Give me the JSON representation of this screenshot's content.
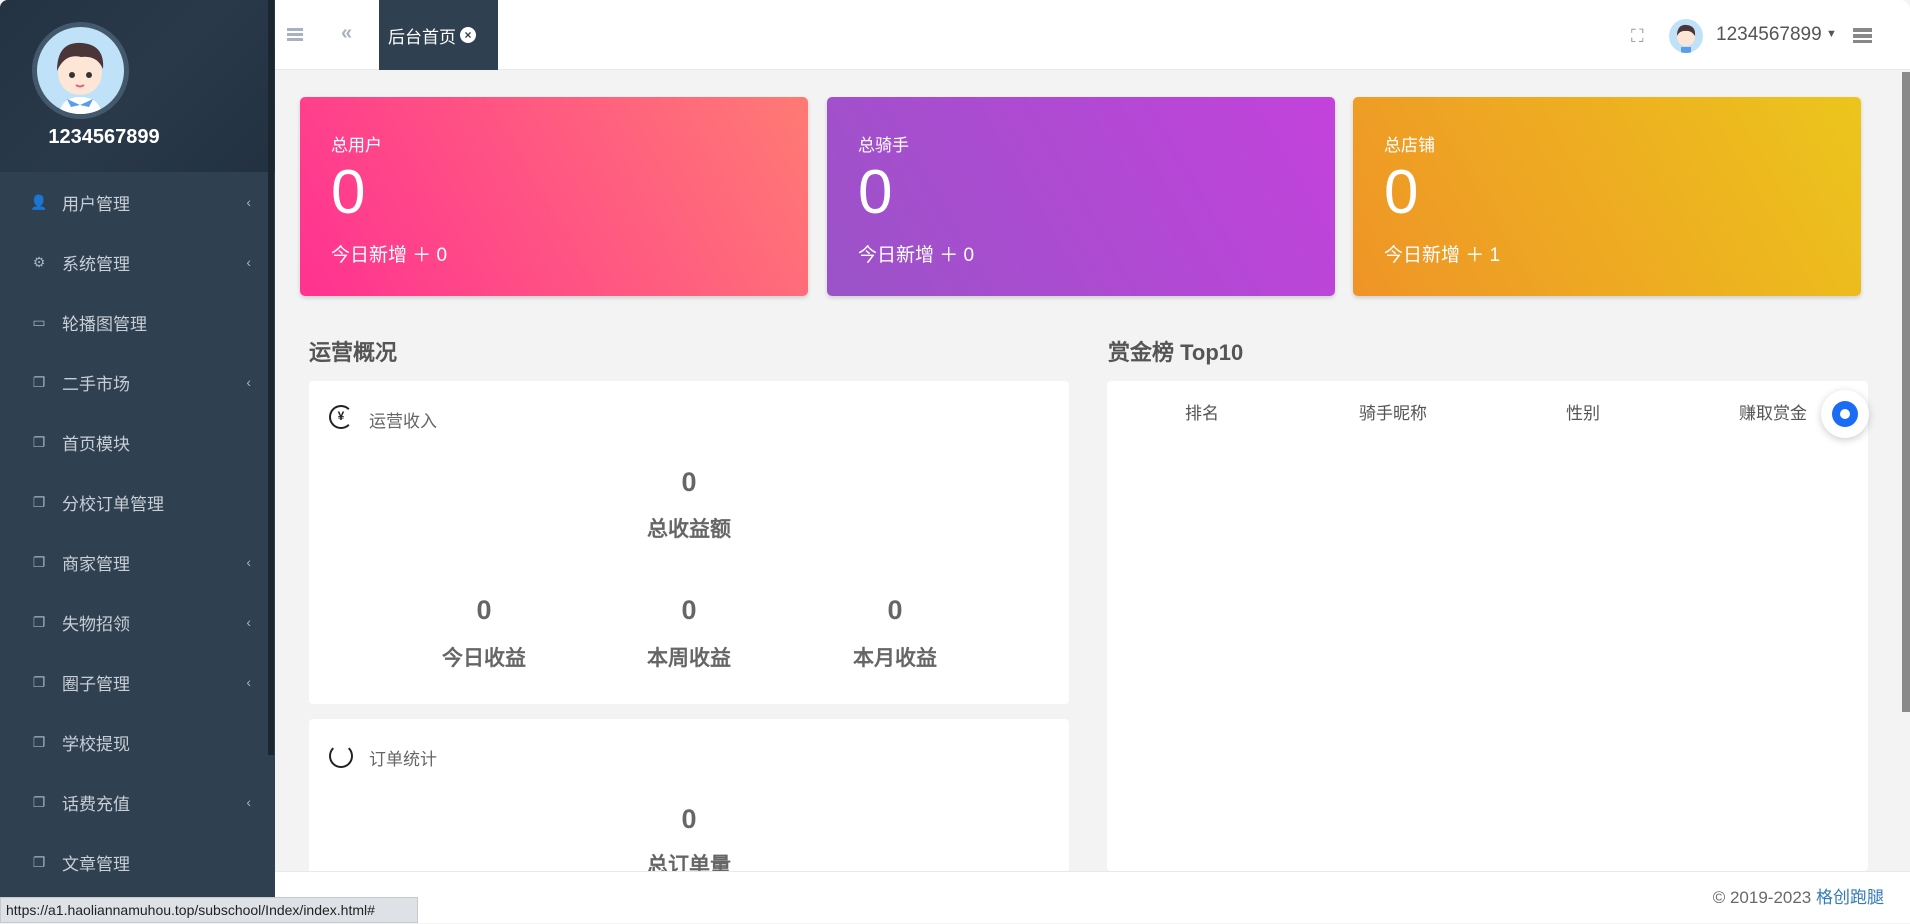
{
  "sidebar": {
    "username": "1234567899",
    "items": [
      {
        "label": "用户管理",
        "icon": "user-icon",
        "chevron": true
      },
      {
        "label": "系统管理",
        "icon": "gears-icon",
        "chevron": true
      },
      {
        "label": "轮播图管理",
        "icon": "monitor-icon",
        "chevron": false
      },
      {
        "label": "二手市场",
        "icon": "copy-icon",
        "chevron": true
      },
      {
        "label": "首页模块",
        "icon": "copy-icon",
        "chevron": false
      },
      {
        "label": "分校订单管理",
        "icon": "copy-icon",
        "chevron": false
      },
      {
        "label": "商家管理",
        "icon": "copy-icon",
        "chevron": true
      },
      {
        "label": "失物招领",
        "icon": "copy-icon",
        "chevron": true
      },
      {
        "label": "圈子管理",
        "icon": "copy-icon",
        "chevron": true
      },
      {
        "label": "学校提现",
        "icon": "copy-icon",
        "chevron": false
      },
      {
        "label": "话费充值",
        "icon": "copy-icon",
        "chevron": true
      },
      {
        "label": "文章管理",
        "icon": "copy-icon",
        "chevron": false
      }
    ]
  },
  "header": {
    "tab": "后台首页",
    "username": "1234567899"
  },
  "cards": [
    {
      "label": "总用户",
      "value": "0",
      "sub": "今日新增 ＋ 0"
    },
    {
      "label": "总骑手",
      "value": "0",
      "sub": "今日新增 ＋ 0"
    },
    {
      "label": "总店铺",
      "value": "0",
      "sub": "今日新增 ＋ 1"
    }
  ],
  "overview": {
    "title": "运营概况",
    "income": {
      "title": "运营收入",
      "total": "0",
      "total_label": "总收益额",
      "today": "0",
      "today_label": "今日收益",
      "week": "0",
      "week_label": "本周收益",
      "month": "0",
      "month_label": "本月收益"
    },
    "orders": {
      "title": "订单统计",
      "total": "0",
      "total_label": "总订单量"
    }
  },
  "ranking": {
    "title": "赏金榜 Top10",
    "columns": [
      "排名",
      "骑手昵称",
      "性别",
      "赚取赏金"
    ]
  },
  "footer": {
    "copyright": "© 2019-2023 ",
    "brand": "格创跑腿"
  },
  "status_url": "https://a1.haoliannamuhou.top/subschool/Index/index.html#"
}
